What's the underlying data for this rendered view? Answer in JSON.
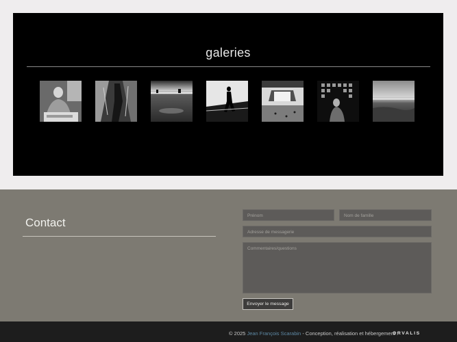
{
  "galleries": {
    "title": "galeries",
    "thumbnails": [
      {
        "icon": "portrait-photo",
        "alt": ""
      },
      {
        "icon": "hanging-figures-photo",
        "alt": ""
      },
      {
        "icon": "wet-ground-photo",
        "alt": ""
      },
      {
        "icon": "silhouette-walker-photo",
        "alt": ""
      },
      {
        "icon": "archway-photo",
        "alt": ""
      },
      {
        "icon": "window-grid-photo",
        "alt": ""
      },
      {
        "icon": "seascape-photo",
        "alt": ""
      }
    ]
  },
  "contact": {
    "title": "Contact",
    "fields": {
      "prenom_placeholder": "Prénom",
      "nom_placeholder": "Nom de famille",
      "email_placeholder": "Adresse de messagerie",
      "message_placeholder": "Commentaires/questions"
    },
    "submit_label": "Envoyer le message"
  },
  "footer": {
    "copyright_prefix": "© 2025",
    "author_link": "Jean François Scarabin",
    "credits_text": "- Conception, réalisation et hébergement :",
    "brand": "ORVALIS"
  },
  "colors": {
    "gallery_bg": "#000000",
    "contact_bg": "#7d7a72",
    "footer_bg": "#1d1d1d",
    "link": "#5e8aa6"
  }
}
